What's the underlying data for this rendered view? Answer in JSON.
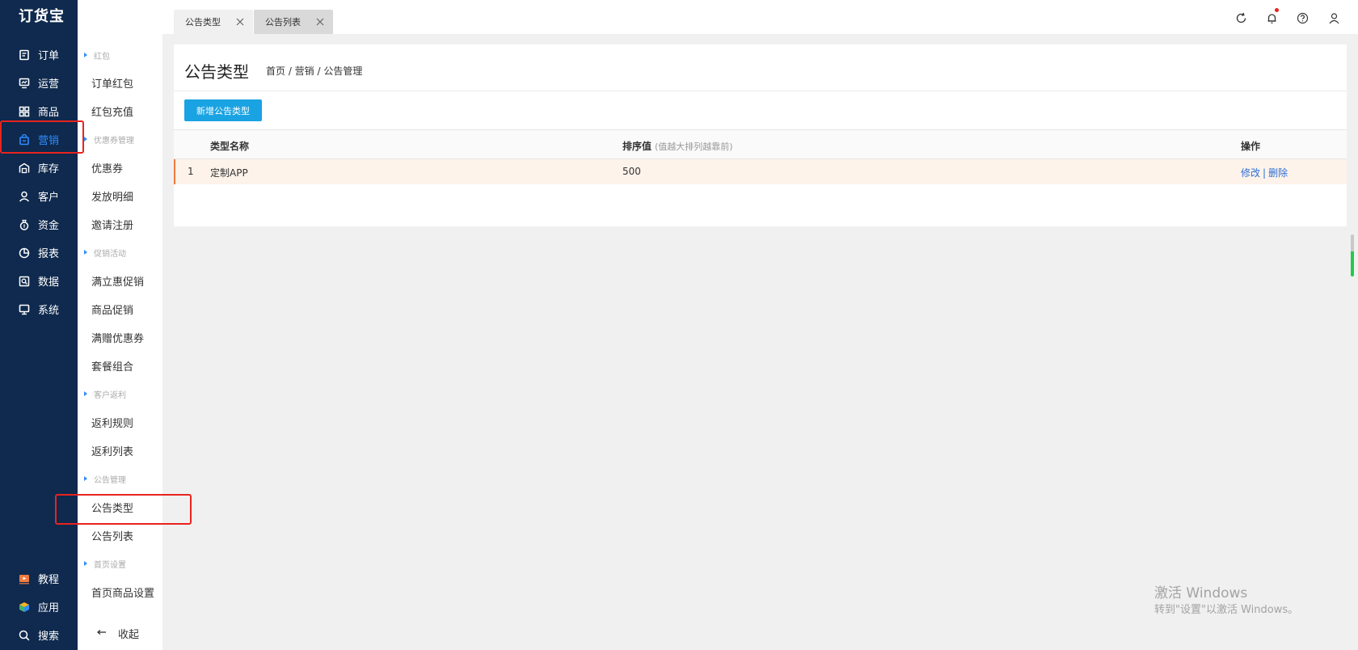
{
  "app": {
    "logo_text": "订货宝"
  },
  "leftnav": {
    "items": [
      {
        "label": "订单",
        "icon": "order-icon"
      },
      {
        "label": "运营",
        "icon": "operation-icon"
      },
      {
        "label": "商品",
        "icon": "grid-icon"
      },
      {
        "label": "营销",
        "icon": "bag-icon",
        "active": true
      },
      {
        "label": "库存",
        "icon": "warehouse-icon"
      },
      {
        "label": "客户",
        "icon": "user-icon"
      },
      {
        "label": "资金",
        "icon": "moneybag-icon"
      },
      {
        "label": "报表",
        "icon": "pie-icon"
      },
      {
        "label": "数据",
        "icon": "data-icon"
      },
      {
        "label": "系统",
        "icon": "monitor-icon"
      }
    ],
    "bottom": [
      {
        "label": "教程",
        "icon": "video-icon"
      },
      {
        "label": "应用",
        "icon": "cube-icon"
      },
      {
        "label": "搜索",
        "icon": "search-icon"
      }
    ]
  },
  "subnav": {
    "groups": {
      "hongbao": "红包",
      "coupon_mgmt": "优惠券管理",
      "promo": "促销活动",
      "rebate": "客户返利",
      "notice": "公告管理",
      "home": "首页设置"
    },
    "items": {
      "order_hongbao": "订单红包",
      "hongbao_recharge": "红包充值",
      "coupon": "优惠券",
      "issue_detail": "发放明细",
      "invite_register": "邀请注册",
      "instant_promo": "满立惠促销",
      "product_promo": "商品促销",
      "gift_coupon": "满赠优惠券",
      "bundle": "套餐组合",
      "rebate_rules": "返利规则",
      "rebate_list": "返利列表",
      "notice_type": "公告类型",
      "notice_list": "公告列表",
      "home_product": "首页商品设置"
    },
    "collapse_label": "收起"
  },
  "tabs": [
    {
      "label": "公告类型",
      "active": true
    },
    {
      "label": "公告列表",
      "active": false
    }
  ],
  "topbar": {
    "icons": [
      "refresh-icon",
      "bell-icon",
      "help-icon",
      "user-icon"
    ]
  },
  "page": {
    "title": "公告类型",
    "breadcrumb": "首页 / 营销 / 公告管理",
    "add_button": "新增公告类型"
  },
  "table": {
    "headers": {
      "name": "类型名称",
      "sort": "排序值",
      "sort_hint": "(值越大排列越靠前)",
      "ops": "操作"
    },
    "rows": [
      {
        "index": "1",
        "name": "定制APP",
        "sort": "500",
        "edit": "修改",
        "sep": "|",
        "delete": "删除"
      }
    ]
  },
  "watermark": {
    "line1": "激活 Windows",
    "line2": "转到\"设置\"以激活 Windows。"
  },
  "colors": {
    "nav_bg": "#0f2a4e",
    "accent": "#2f8cff",
    "button": "#1aa3e2",
    "highlight": "#e8231f"
  }
}
